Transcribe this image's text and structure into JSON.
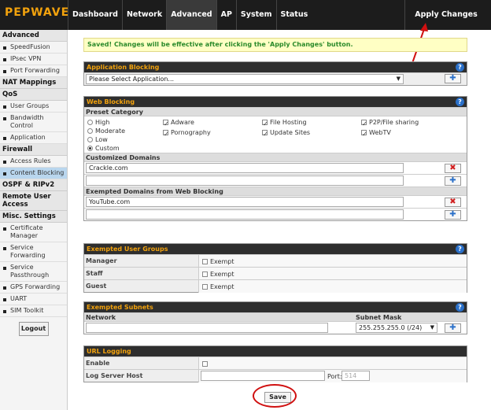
{
  "brand": "PEPWAVE",
  "nav": [
    "Dashboard",
    "Network",
    "Advanced",
    "AP",
    "System",
    "Status"
  ],
  "apply_changes": "Apply Changes",
  "sidebar": {
    "advanced": "Advanced",
    "adv_items": [
      "SpeedFusion",
      "IPsec VPN",
      "Port Forwarding"
    ],
    "nat": "NAT Mappings",
    "qos": "QoS",
    "qos_items": [
      "User Groups",
      "Bandwidth Control",
      "Application"
    ],
    "firewall": "Firewall",
    "fw_items": [
      "Access Rules",
      "Content Blocking"
    ],
    "ospf": "OSPF & RIPv2",
    "remote": "Remote User Access",
    "misc": "Misc. Settings",
    "misc_items": [
      "Certificate Manager",
      "Service Forwarding",
      "Service Passthrough",
      "GPS Forwarding",
      "UART",
      "SIM Toolkit"
    ],
    "logout": "Logout"
  },
  "notice": "Saved! Changes will be effective after clicking the 'Apply Changes' button.",
  "app_blocking": {
    "title": "Application Blocking",
    "select": "Please Select Application..."
  },
  "web_blocking": {
    "title": "Web Blocking",
    "preset_category": "Preset Category",
    "radios": [
      "High",
      "Moderate",
      "Low",
      "Custom"
    ],
    "checks": [
      "Adware",
      "Pornography",
      "File Hosting",
      "Update Sites",
      "P2P/File sharing",
      "WebTV"
    ],
    "customized_domains": "Customized Domains",
    "custom_domain_value": "Crackle.com",
    "exempted_domains": "Exempted Domains from Web Blocking",
    "exempt_domain_value": "YouTube.com"
  },
  "exempted_user_groups": {
    "title": "Exempted User Groups",
    "rows": [
      {
        "group": "Manager",
        "label": "Exempt"
      },
      {
        "group": "Staff",
        "label": "Exempt"
      },
      {
        "group": "Guest",
        "label": "Exempt"
      }
    ]
  },
  "exempted_subnets": {
    "title": "Exempted Subnets",
    "network_col": "Network",
    "mask_col": "Subnet Mask",
    "mask_value": "255.255.255.0 (/24)"
  },
  "url_logging": {
    "title": "URL Logging",
    "enable": "Enable",
    "log_server_host": "Log Server Host",
    "port_label": "Port:",
    "port_placeholder": "514"
  },
  "save": "Save",
  "colors": {
    "accent": "#f2a20d",
    "highlight": "#d01010",
    "link": "#2a70c9"
  }
}
